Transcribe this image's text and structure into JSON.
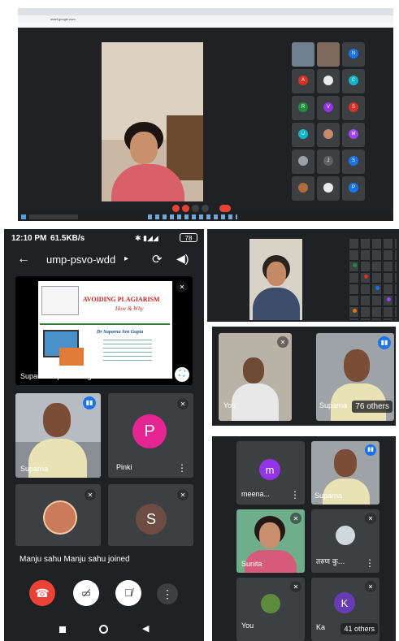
{
  "colors": {
    "desktop_bg": "#202124",
    "tile_bg": "#3c4043",
    "end_call": "#ea4335",
    "panel_bg": "#202124",
    "accent_blue": "#1a73e8"
  },
  "desktop": {
    "browser_url": "meet.google.com",
    "grid_names": [
      "",
      "",
      "",
      "",
      "",
      "",
      "",
      "",
      "",
      "",
      "",
      "",
      "",
      "",
      "",
      "",
      "",
      "",
      "",
      ""
    ],
    "presenter_label": "",
    "taskbar_time": ""
  },
  "phone": {
    "status_time": "12:10 PM",
    "status_speed": "61.5KB/s",
    "battery": "78",
    "meeting_code": "ump-psvo-wdd",
    "slide": {
      "title": "AVOIDING PLAGIARISM",
      "subtitle": "How & Why",
      "author": "Dr Suparna Sen Gupta"
    },
    "presenter_label": "Suparna is presenting",
    "tiles": {
      "suparna": "Suparna",
      "pinki": "Pinki",
      "pinki_initial": "P",
      "s_initial": "S"
    },
    "join_message": "Manju sahu Manju sahu joined"
  },
  "top_right": {
    "grid_count": 24
  },
  "mid_right": {
    "you_label": "You",
    "suparna_label": "Suparna",
    "others": "76 others"
  },
  "bottom_right": {
    "meena": "meena...",
    "meena_initial": "m",
    "suparna": "Suparna",
    "sunita": "Sunita",
    "hindi_name": "तरुण कु...",
    "you": "You",
    "ka": "Ka",
    "k_initial": "K",
    "others": "41 others"
  }
}
